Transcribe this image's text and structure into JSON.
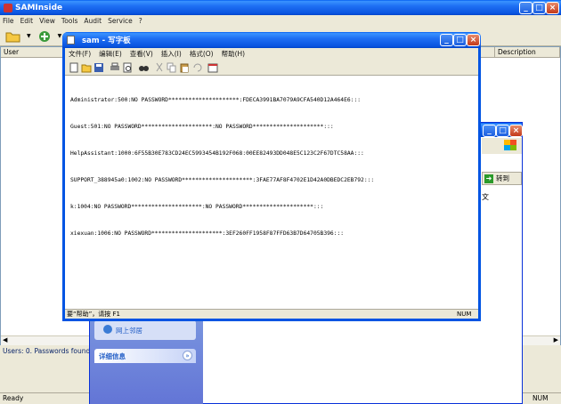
{
  "sam": {
    "title": "SAMInside",
    "menu": [
      "File",
      "Edit",
      "View",
      "Tools",
      "Audit",
      "Service",
      "?"
    ],
    "columns": {
      "user": "User",
      "description": "Description"
    },
    "info": "Users: 0. Passwords found",
    "status": "Ready",
    "status_num": "NUM"
  },
  "explorer": {
    "goto_label": "转到",
    "side_link": "网上邻居",
    "details_label": "详细信息",
    "partial_text": "文"
  },
  "notepad": {
    "title": "sam - 写字板",
    "menu": [
      "文件(F)",
      "编辑(E)",
      "查看(V)",
      "插入(I)",
      "格式(O)",
      "帮助(H)"
    ],
    "lines": [
      "Administrator:500:NO PASSWORD*********************:FDECA3991BA7079A9CFA540D12A464E6:::",
      "Guest:501:NO PASSWORD*********************:NO PASSWORD*********************:::",
      "HelpAssistant:1000:6F55B30E783CD24EC5993454B192F068:00EE82493DD048E5C123C2F67DTC58AA:::",
      "SUPPORT_388945a0:1002:NO PASSWORD*********************:3FAE77AF8F4702E1D42A0DBEDC2EB792:::",
      "k:1004:NO PASSWORD*********************:NO PASSWORD*********************:::",
      "xiexuan:1006:NO PASSWORD*********************:3EF260FF1958F87FFD63B7D64705B396:::"
    ],
    "status_help": "要“帮助”，请按 F1",
    "status_num": "NUM"
  }
}
